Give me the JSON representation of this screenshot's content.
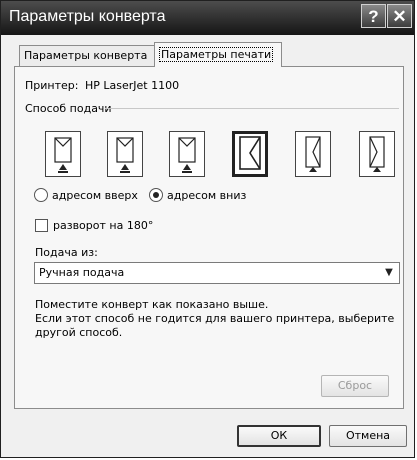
{
  "window": {
    "title": "Параметры конверта",
    "help_label": "?",
    "close_label": "✕"
  },
  "tabs": [
    {
      "label": "Параметры конверта",
      "active": false
    },
    {
      "label": "Параметры печати",
      "active": true
    }
  ],
  "printer": {
    "label": "Принтер:",
    "value": "HP LaserJet 1100"
  },
  "feed_method": {
    "label": "Способ подачи"
  },
  "feed_options": [
    {
      "icon": "envelope-feed-icon",
      "selected": false
    },
    {
      "icon": "envelope-feed-icon",
      "selected": false
    },
    {
      "icon": "envelope-feed-icon",
      "selected": false
    },
    {
      "icon": "envelope-feed-rotated-icon",
      "selected": true
    },
    {
      "icon": "envelope-feed-rotated-icon",
      "selected": false
    },
    {
      "icon": "envelope-feed-rotated-icon",
      "selected": false
    }
  ],
  "orientation": {
    "face_up": {
      "label": "адресом вверх",
      "checked": false
    },
    "face_down": {
      "label": "адресом вниз",
      "checked": true
    }
  },
  "rotate": {
    "label": "разворот на 180°",
    "checked": false
  },
  "feed_from": {
    "label": "Подача из:",
    "value": "Ручная подача"
  },
  "instructions": [
    "Поместите конверт как показано выше.",
    "Если этот способ не годится для вашего принтера, выберите",
    "другой способ."
  ],
  "reset_label": "Сброс",
  "ok_label": "ОК",
  "cancel_label": "Отмена"
}
